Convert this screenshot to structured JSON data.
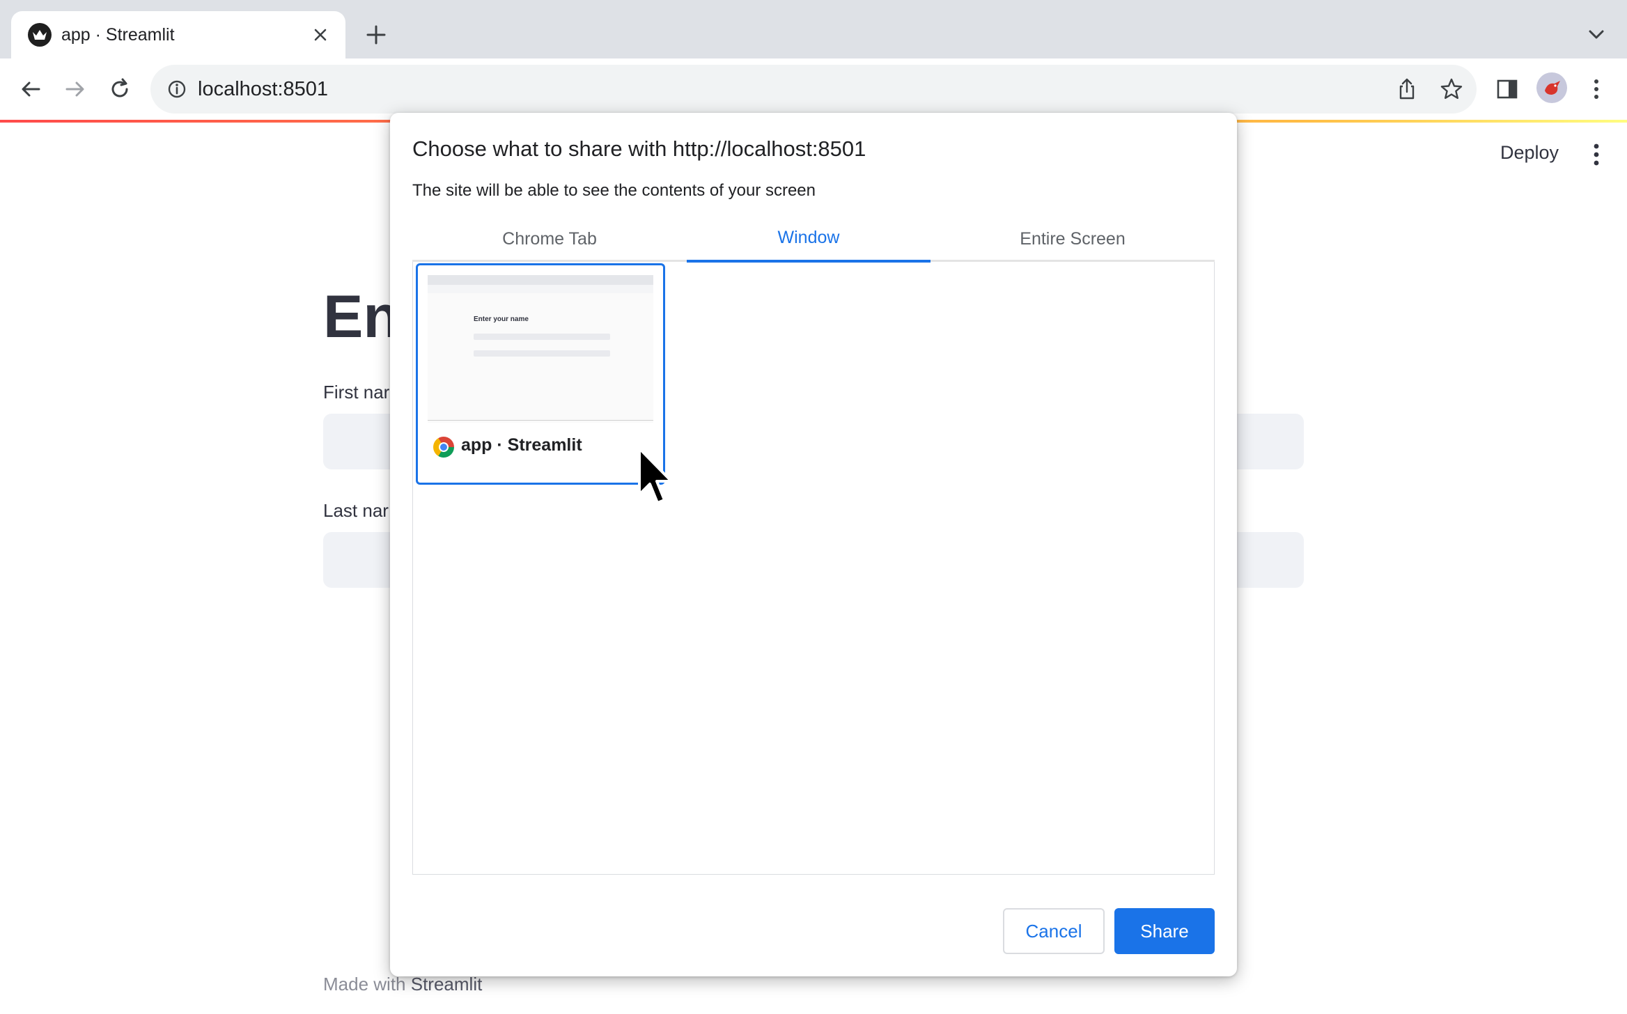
{
  "browser": {
    "tab": {
      "title": "app · Streamlit"
    },
    "omnibox": {
      "url": "localhost:8501"
    }
  },
  "page": {
    "header": {
      "deploy_label": "Deploy"
    },
    "heading": "En",
    "fields": [
      {
        "label": "First nar"
      },
      {
        "label": "Last nar"
      }
    ],
    "footer": {
      "prefix": "Made with ",
      "brand": "Streamlit"
    }
  },
  "dialog": {
    "title": "Choose what to share with http://localhost:8501",
    "subtitle": "The site will be able to see the contents of your screen",
    "tabs": [
      {
        "label": "Chrome Tab",
        "active": false
      },
      {
        "label": "Window",
        "active": true
      },
      {
        "label": "Entire Screen",
        "active": false
      }
    ],
    "sources": [
      {
        "label": "app · Streamlit",
        "icon": "chrome-icon",
        "selected": true,
        "preview_heading": "Enter your name"
      }
    ],
    "buttons": {
      "cancel": "Cancel",
      "share": "Share"
    }
  },
  "colors": {
    "accent": "#1a73e8",
    "streamlit_gradient_start": "#ff4b4b",
    "streamlit_gradient_end": "#fffd80",
    "tabstrip": "#dee1e6",
    "input_bg": "#f0f2f6"
  }
}
